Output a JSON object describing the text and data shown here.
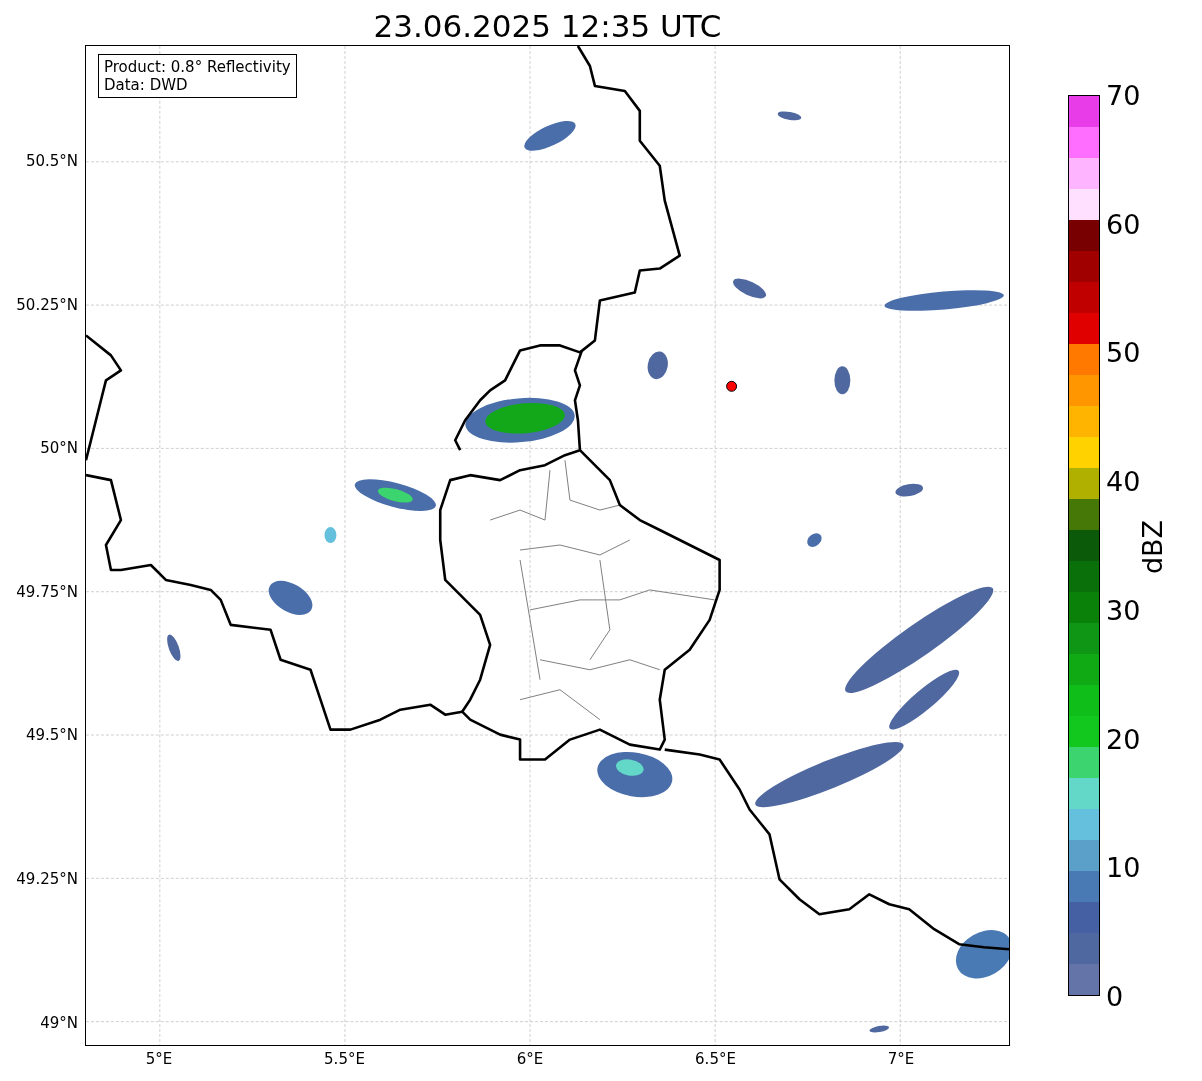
{
  "title": "23.06.2025 12:35 UTC",
  "info_box": [
    "Product: 0.8° Reflectivity",
    "Data: DWD"
  ],
  "y_ticks": [
    "50.5°N",
    "50.25°N",
    "50°N",
    "49.75°N",
    "49.5°N",
    "49.25°N",
    "49°N"
  ],
  "x_ticks": [
    "5°E",
    "5.5°E",
    "6°E",
    "6.5°E",
    "7°E"
  ],
  "colorbar": {
    "label": "dBZ",
    "ticks": [
      "70",
      "60",
      "50",
      "40",
      "30",
      "20",
      "10",
      "0"
    ],
    "bins": [
      {
        "color": "#e83ce8"
      },
      {
        "color": "#ff6eff"
      },
      {
        "color": "#ffb4ff"
      },
      {
        "color": "#ffe0ff"
      },
      {
        "color": "#780000"
      },
      {
        "color": "#a00000"
      },
      {
        "color": "#c00000"
      },
      {
        "color": "#e00000"
      },
      {
        "color": "#ff7800"
      },
      {
        "color": "#ff9600"
      },
      {
        "color": "#ffb400"
      },
      {
        "color": "#ffd200"
      },
      {
        "color": "#b0b000"
      },
      {
        "color": "#467808"
      },
      {
        "color": "#0a5a0a"
      },
      {
        "color": "#0a700a"
      },
      {
        "color": "#0a820a"
      },
      {
        "color": "#0e9614"
      },
      {
        "color": "#10aa14"
      },
      {
        "color": "#10be1a"
      },
      {
        "color": "#12c81e"
      },
      {
        "color": "#3cd46e"
      },
      {
        "color": "#64d8c8"
      },
      {
        "color": "#64c0dc"
      },
      {
        "color": "#5aa0c8"
      },
      {
        "color": "#4a7ab4"
      },
      {
        "color": "#4660a4"
      },
      {
        "color": "#5068a0"
      },
      {
        "color": "#6474a8"
      }
    ]
  }
}
